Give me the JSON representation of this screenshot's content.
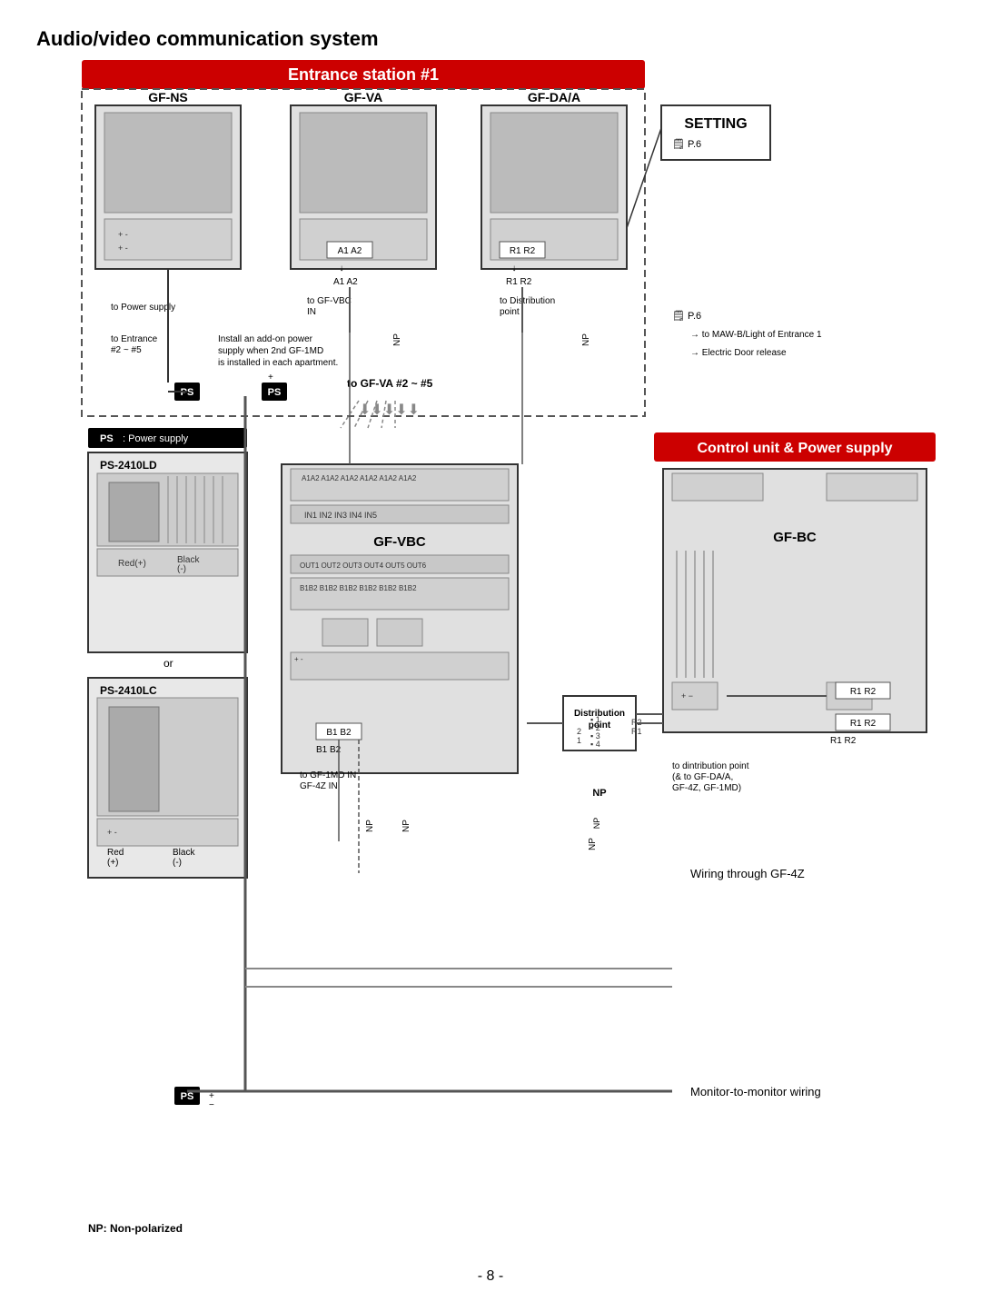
{
  "title": "Audio/video communication system",
  "entrance_station": "Entrance station #1",
  "control_unit": "Control unit & Power supply",
  "setting_label": "SETTING",
  "setting_page": "P.6",
  "devices": {
    "gf_ns": "GF-NS",
    "gf_va": "GF-VA",
    "gf_da": "GF-DA/A",
    "gf_vbc": "GF-VBC",
    "gf_bc": "GF-BC",
    "ps_label": "PS",
    "ps_power": "PS : Power supply",
    "ps_2410ld": "PS-2410LD",
    "ps_2410lc": "PS-2410LC",
    "or_label": "or"
  },
  "terminals": {
    "a1a2_top": "A1 A2",
    "a1a2_bot": "A1  A2",
    "r1r2_top": "R1 R2",
    "r1r2_bot": "R1  R2",
    "b1b2_top": "B1 B2",
    "b1b2_bot": "B1  B2",
    "r1r2_right_top": "R1   R2",
    "r1r2_right_bot": "R1  R2",
    "in_labels": "IN1 IN2 IN3 IN4 IN5",
    "out_labels": "OUT1 OUT2 OUT3 OUT4 OUT5 OUT6"
  },
  "annotations": {
    "to_power_supply": "to Power supply",
    "to_entrance": "to Entrance\n#2 ~ #5",
    "to_gf_vbc_in": "to GF-VBC\nIN",
    "to_distribution": "to Distribution\npoint",
    "to_gfva": "to GF-VA #2 ~ #5",
    "to_gf1md": "to GF-1MD IN\nGF-4Z IN",
    "distribution_point": "Distribution\npoint",
    "wiring_through": "Wiring through GF-4Z",
    "monitor_wiring": "Monitor-to-monitor wiring",
    "np_label": "NP: Non-polarized",
    "maw_b": "to MAW-B/Light of Entrance 1",
    "electric_door": "Electric Door release",
    "install_addon": "Install an add-on power\nsupply when 2nd GF-1MD\nis installed in each apartment.",
    "red_plus": "Red(+)",
    "black_minus": "Black\n(-)",
    "red_plus2": "Red\n(+)",
    "black_minus2": "Black\n(-)",
    "np": "NP",
    "page_number": "- 8 -"
  },
  "colors": {
    "entrance_header_bg": "#cc0000",
    "control_header_bg": "#cc0000",
    "ps_badge_bg": "#000000",
    "ps_badge_text": "#ffffff",
    "dashed_border": "#555555",
    "device_border": "#333333",
    "setting_box_bg": "#ffffff",
    "setting_box_border": "#333333"
  }
}
